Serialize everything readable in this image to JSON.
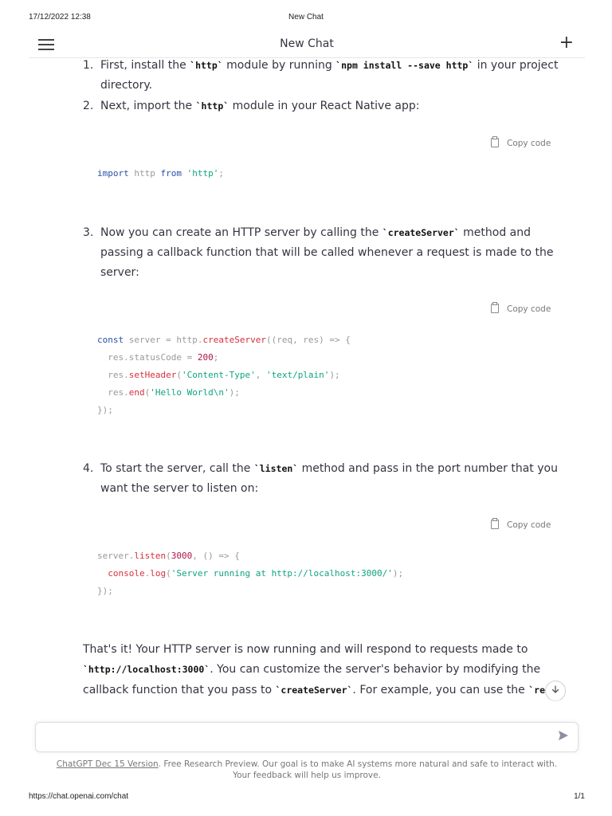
{
  "print": {
    "datetime": "17/12/2022 12:38",
    "page_title": "New Chat",
    "url": "https://chat.openai.com/chat",
    "page_number": "1/1"
  },
  "topbar": {
    "title": "New Chat",
    "menu_icon": "hamburger-menu-icon",
    "new_chat_icon": "plus-icon"
  },
  "message": {
    "steps": [
      {
        "number": "1.",
        "parts": [
          "First, install the ",
          "`http`",
          " module by running ",
          "`npm install --save http`",
          " in your project",
          "directory."
        ]
      },
      {
        "number": "2.",
        "parts": [
          "Next, import the ",
          "`http`",
          " module in your React Native app:"
        ]
      },
      {
        "number": "3.",
        "parts": [
          "Now you can create an HTTP server by calling the ",
          "`createServer`",
          " method and",
          "passing a callback function that will be called whenever a request is made to the",
          "server:"
        ]
      },
      {
        "number": "4.",
        "parts": [
          "To start the server, call the ",
          "`listen`",
          " method and pass in the port number that you",
          "want the server to listen on:"
        ]
      }
    ],
    "copy_label": "Copy code",
    "code_blocks": [
      {
        "lines": [
          [
            [
              "import",
              "kw"
            ],
            [
              " http ",
              ""
            ],
            [
              "from",
              "kw"
            ],
            [
              " ",
              ""
            ],
            [
              "'http'",
              "str"
            ],
            [
              ";",
              ""
            ]
          ]
        ]
      },
      {
        "lines": [
          [
            [
              "const",
              "kw"
            ],
            [
              " server = http.",
              ""
            ],
            [
              "createServer",
              "fn"
            ],
            [
              "((req, res) => {",
              ""
            ]
          ],
          [
            [
              "  res.statusCode = ",
              ""
            ],
            [
              "200",
              "numl"
            ],
            [
              ";",
              ""
            ]
          ],
          [
            [
              "  res.",
              ""
            ],
            [
              "setHeader",
              "fn"
            ],
            [
              "(",
              ""
            ],
            [
              "'Content-Type'",
              "str"
            ],
            [
              ", ",
              ""
            ],
            [
              "'text/plain'",
              "str"
            ],
            [
              ");",
              ""
            ]
          ],
          [
            [
              "  res.",
              ""
            ],
            [
              "end",
              "fn"
            ],
            [
              "(",
              ""
            ],
            [
              "'Hello World\\n'",
              "str"
            ],
            [
              ");",
              ""
            ]
          ],
          [
            [
              "});",
              ""
            ]
          ]
        ]
      },
      {
        "lines": [
          [
            [
              "server.",
              ""
            ],
            [
              "listen",
              "fn"
            ],
            [
              "(",
              ""
            ],
            [
              "3000",
              "numl"
            ],
            [
              ", () => {",
              ""
            ]
          ],
          [
            [
              "  ",
              ""
            ],
            [
              "console",
              "fn"
            ],
            [
              ".",
              ""
            ],
            [
              "log",
              "fn"
            ],
            [
              "(",
              ""
            ],
            [
              "'Server running at http://localhost:3000/'",
              "str"
            ],
            [
              ");",
              ""
            ]
          ],
          [
            [
              "});",
              ""
            ]
          ]
        ]
      }
    ],
    "closing": {
      "line1": "That's it! Your HTTP server is now running and will respond to requests made to",
      "line2_code": "`http://localhost:3000`",
      "line2_text": ". You can customize the server's behavior by modifying the",
      "line3_text": "callback function that you pass to ",
      "line3_code": "`createServer`",
      "line3_text2": ". For example, you can use the ",
      "line3_code2": "`req"
    }
  },
  "scroll_down_icon": "arrow-down-icon",
  "composer": {
    "placeholder": "",
    "send_icon": "send-icon"
  },
  "footer": {
    "link": "ChatGPT Dec 15 Version",
    "text": ". Free Research Preview. Our goal is to make AI systems more natural and safe to interact with. Your feedback will help us improve."
  }
}
